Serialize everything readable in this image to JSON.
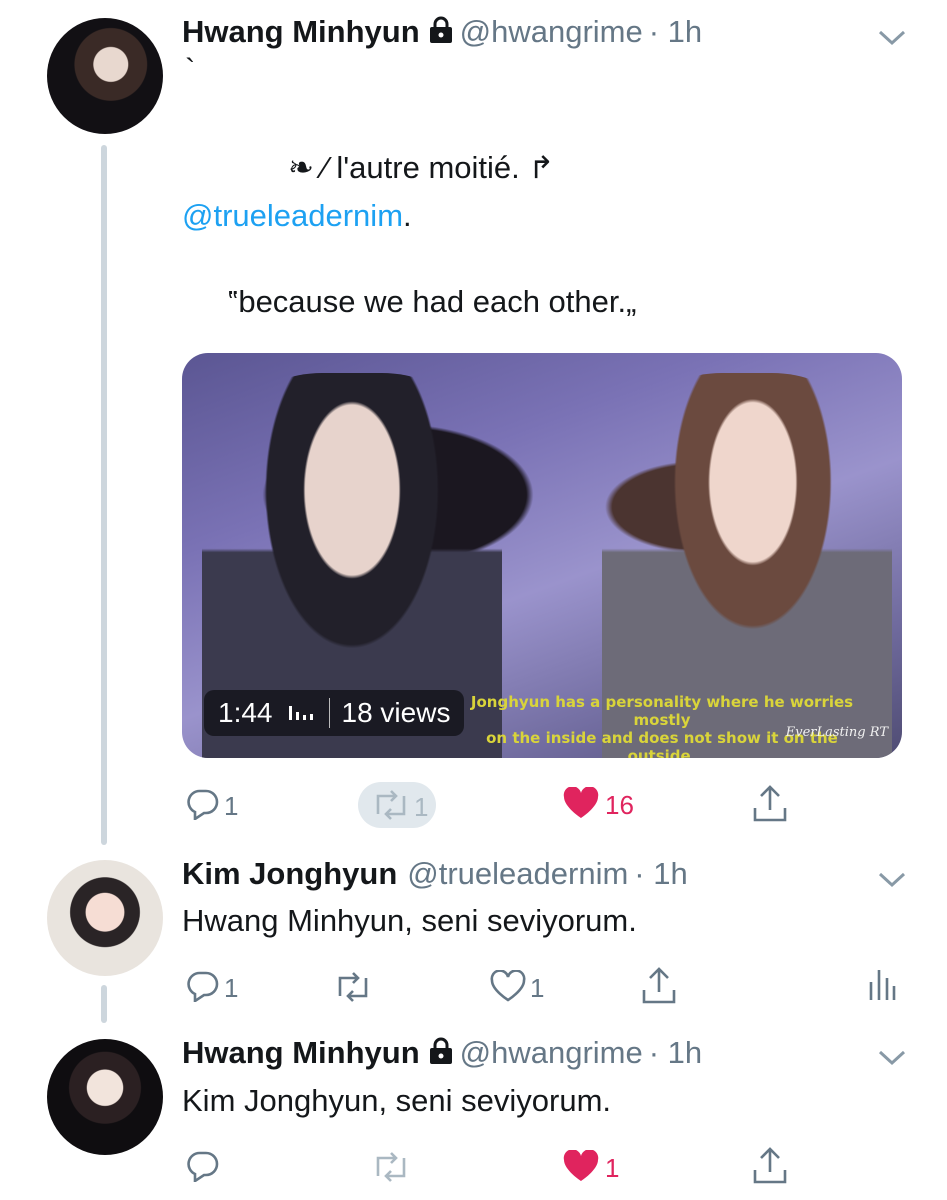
{
  "tweets": [
    {
      "name": "Hwang Minhyun",
      "handle": "@hwangrime",
      "time": "· 1h",
      "tick": "`",
      "line1": "❧ ⁄ l'autre moitié. ↱",
      "mention": "@trueleadernim",
      "mention_suffix": ".",
      "quote": "‟because we had each other.„",
      "video": {
        "duration": "1:44",
        "views": "18 views",
        "caption_line1": "Jonghyun has a personality where he worries mostly",
        "caption_line2": "on the inside and does not show it on the outside.",
        "watermark": "EverLasting RT"
      },
      "replies": "1",
      "retweets": "1",
      "likes": "16",
      "liked": true
    },
    {
      "name": "Kim Jonghyun",
      "handle": "@trueleadernim",
      "time": "· 1h",
      "text": "Hwang Minhyun, seni seviyorum.",
      "replies": "1",
      "retweets": "",
      "likes": "1",
      "liked": false
    },
    {
      "name": "Hwang Minhyun",
      "handle": "@hwangrime",
      "time": "· 1h",
      "text": "Kim Jonghyun, seni seviyorum.",
      "replies": "",
      "retweets": "",
      "likes": "1",
      "liked": true
    }
  ],
  "colors": {
    "like": "#e0245e",
    "icon": "#657786",
    "mention": "#1da1f2",
    "thread_line": "#cdd6dd"
  }
}
